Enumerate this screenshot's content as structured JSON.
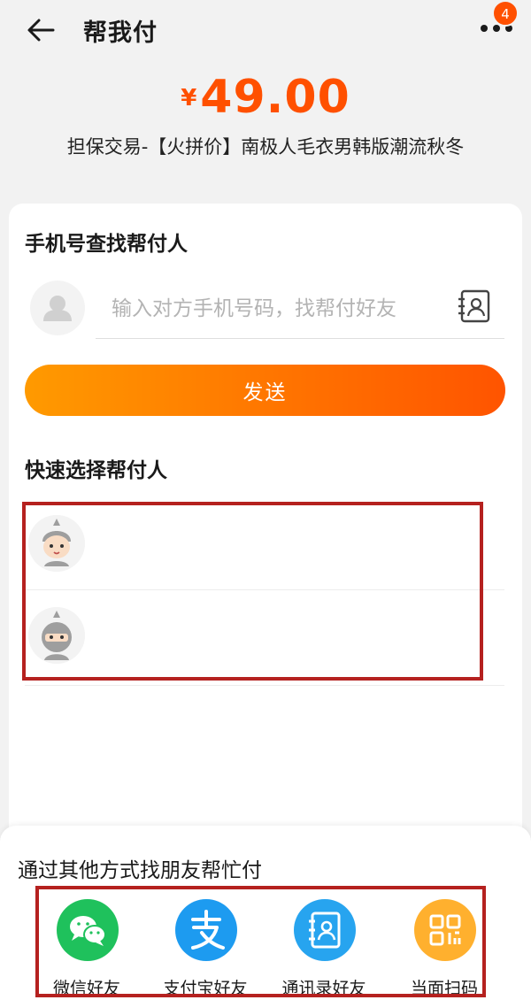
{
  "header": {
    "title": "帮我付",
    "badge_count": "4"
  },
  "order": {
    "currency": "¥",
    "amount": "49.00",
    "description": "担保交易-【火拼价】南极人毛衣男韩版潮流秋冬"
  },
  "phone_search": {
    "title": "手机号查找帮付人",
    "placeholder": "输入对方手机号码，找帮付好友",
    "value": ""
  },
  "send_button": {
    "label": "发送"
  },
  "quick_select": {
    "title": "快速选择帮付人",
    "items": [
      {
        "avatar": "boy-avatar"
      },
      {
        "avatar": "ninja-avatar"
      }
    ]
  },
  "other_methods": {
    "title": "通过其他方式找朋友帮忙付",
    "items": [
      {
        "label": "微信好友",
        "icon": "wechat-icon",
        "color": "#1fc15c"
      },
      {
        "label": "支付宝好友",
        "icon": "alipay-icon",
        "color": "#1d9bf0"
      },
      {
        "label": "通讯录好友",
        "icon": "contacts-book-icon",
        "color": "#27a4ef"
      },
      {
        "label": "当面扫码",
        "icon": "qr-code-icon",
        "color": "#ffb02e"
      }
    ]
  },
  "colors": {
    "accent": "#ff5000",
    "highlight_box": "#b5211f"
  }
}
